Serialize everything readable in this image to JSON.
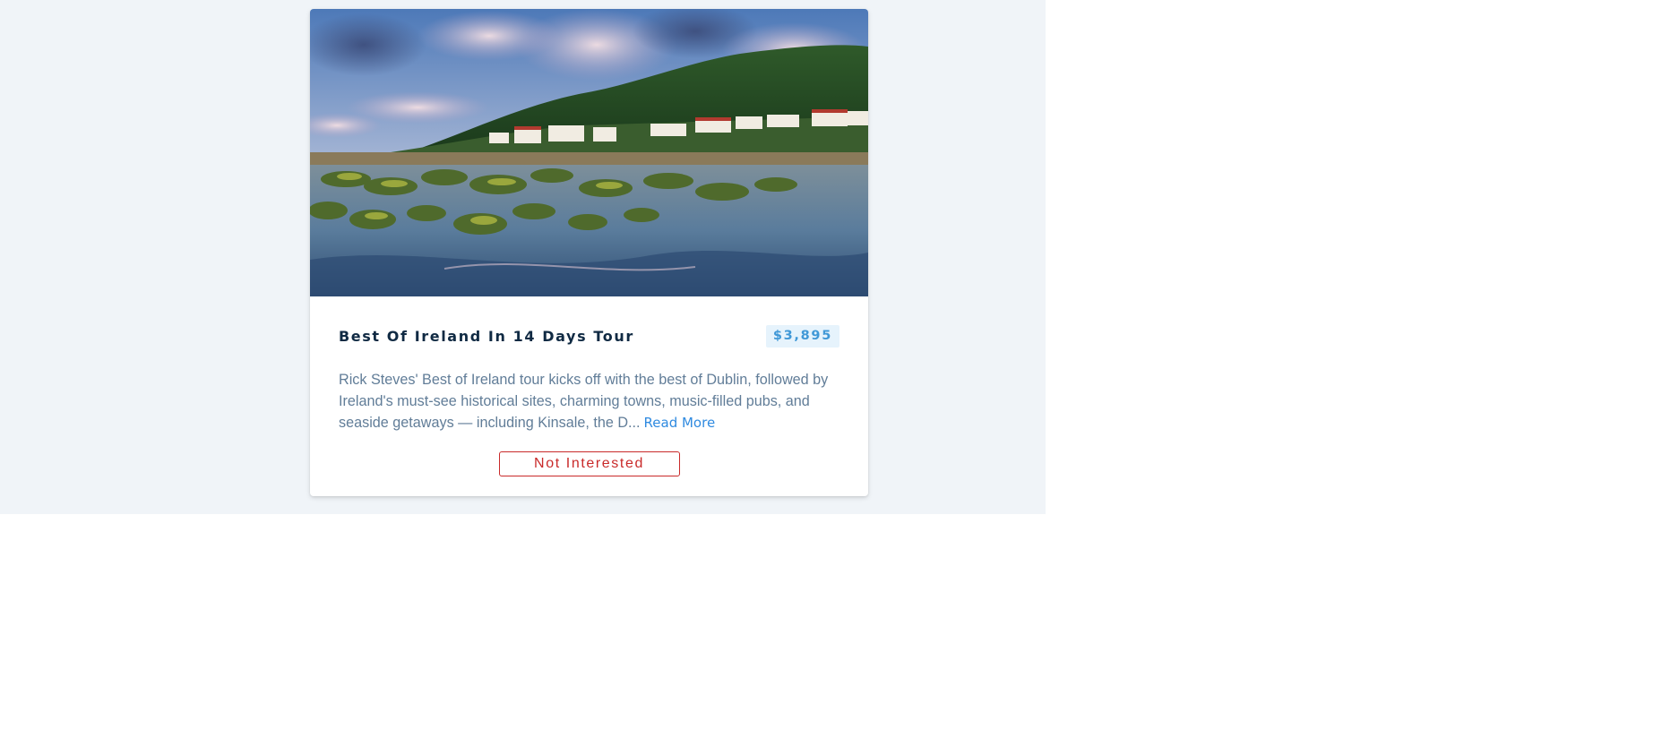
{
  "tour": {
    "image_alt": "Rocky seaside village in Ireland at dusk",
    "title": "Best Of Ireland In 14 Days Tour",
    "price": "$3,895",
    "info": "Rick Steves' Best of Ireland tour kicks off with the best of Dublin, followed by Ireland's must-see historical sites, charming towns, music-filled pubs, and seaside getaways — including Kinsale, the D...",
    "read_more_label": "Read More",
    "not_interested_label": "Not Interested"
  },
  "colors": {
    "page_background": "#f0f4f8",
    "title": "#102a43",
    "price_text": "#4098d7",
    "price_background": "#e6f3fc",
    "body_text": "#617d98",
    "link": "#2f8ae0",
    "danger": "#c92a2a"
  }
}
